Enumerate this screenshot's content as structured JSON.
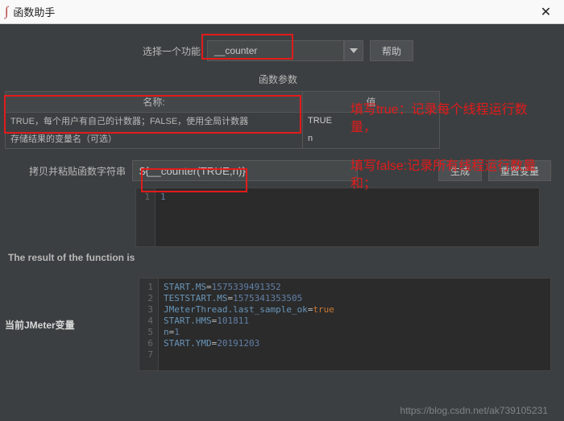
{
  "window": {
    "title": "函数助手"
  },
  "selector": {
    "label": "选择一个功能",
    "value": "__counter",
    "help_btn": "帮助"
  },
  "params": {
    "section_title": "函数参数",
    "head_name": "名称:",
    "head_value": "值",
    "rows": [
      {
        "name": "TRUE，每个用户有自己的计数器；FALSE，使用全局计数器",
        "value": "TRUE"
      },
      {
        "name": "存储结果的变量名（可选）",
        "value": "n"
      }
    ]
  },
  "annotations": {
    "line1": "填写true：记录每个线程运行数量，",
    "line2": "填写false:记录所有线程运行数量和；"
  },
  "generate": {
    "label": "拷贝并粘贴函数字符串",
    "value": "${__counter(TRUE,n)}",
    "generate_btn": "生成",
    "reset_btn": "重置变量"
  },
  "result": {
    "label": "The result of the function is",
    "gutter": [
      "1"
    ],
    "lines": [
      "1"
    ]
  },
  "vars": {
    "label": "当前JMeter变量",
    "gutter": [
      "1",
      "2",
      "3",
      "4",
      "5",
      "6",
      "7"
    ],
    "lines": [
      {
        "key": "START.MS",
        "val": "1575339491352",
        "type": "num"
      },
      {
        "key": "TESTSTART.MS",
        "val": "1575341353505",
        "type": "num"
      },
      {
        "key": "JMeterThread.last_sample_ok",
        "val": "true",
        "type": "bool"
      },
      {
        "key": "START.HMS",
        "val": "101811",
        "type": "num"
      },
      {
        "key": "n",
        "val": "1",
        "type": "num"
      },
      {
        "key": "START.YMD",
        "val": "20191203",
        "type": "num"
      }
    ]
  },
  "watermark": "https://blog.csdn.net/ak739105231"
}
